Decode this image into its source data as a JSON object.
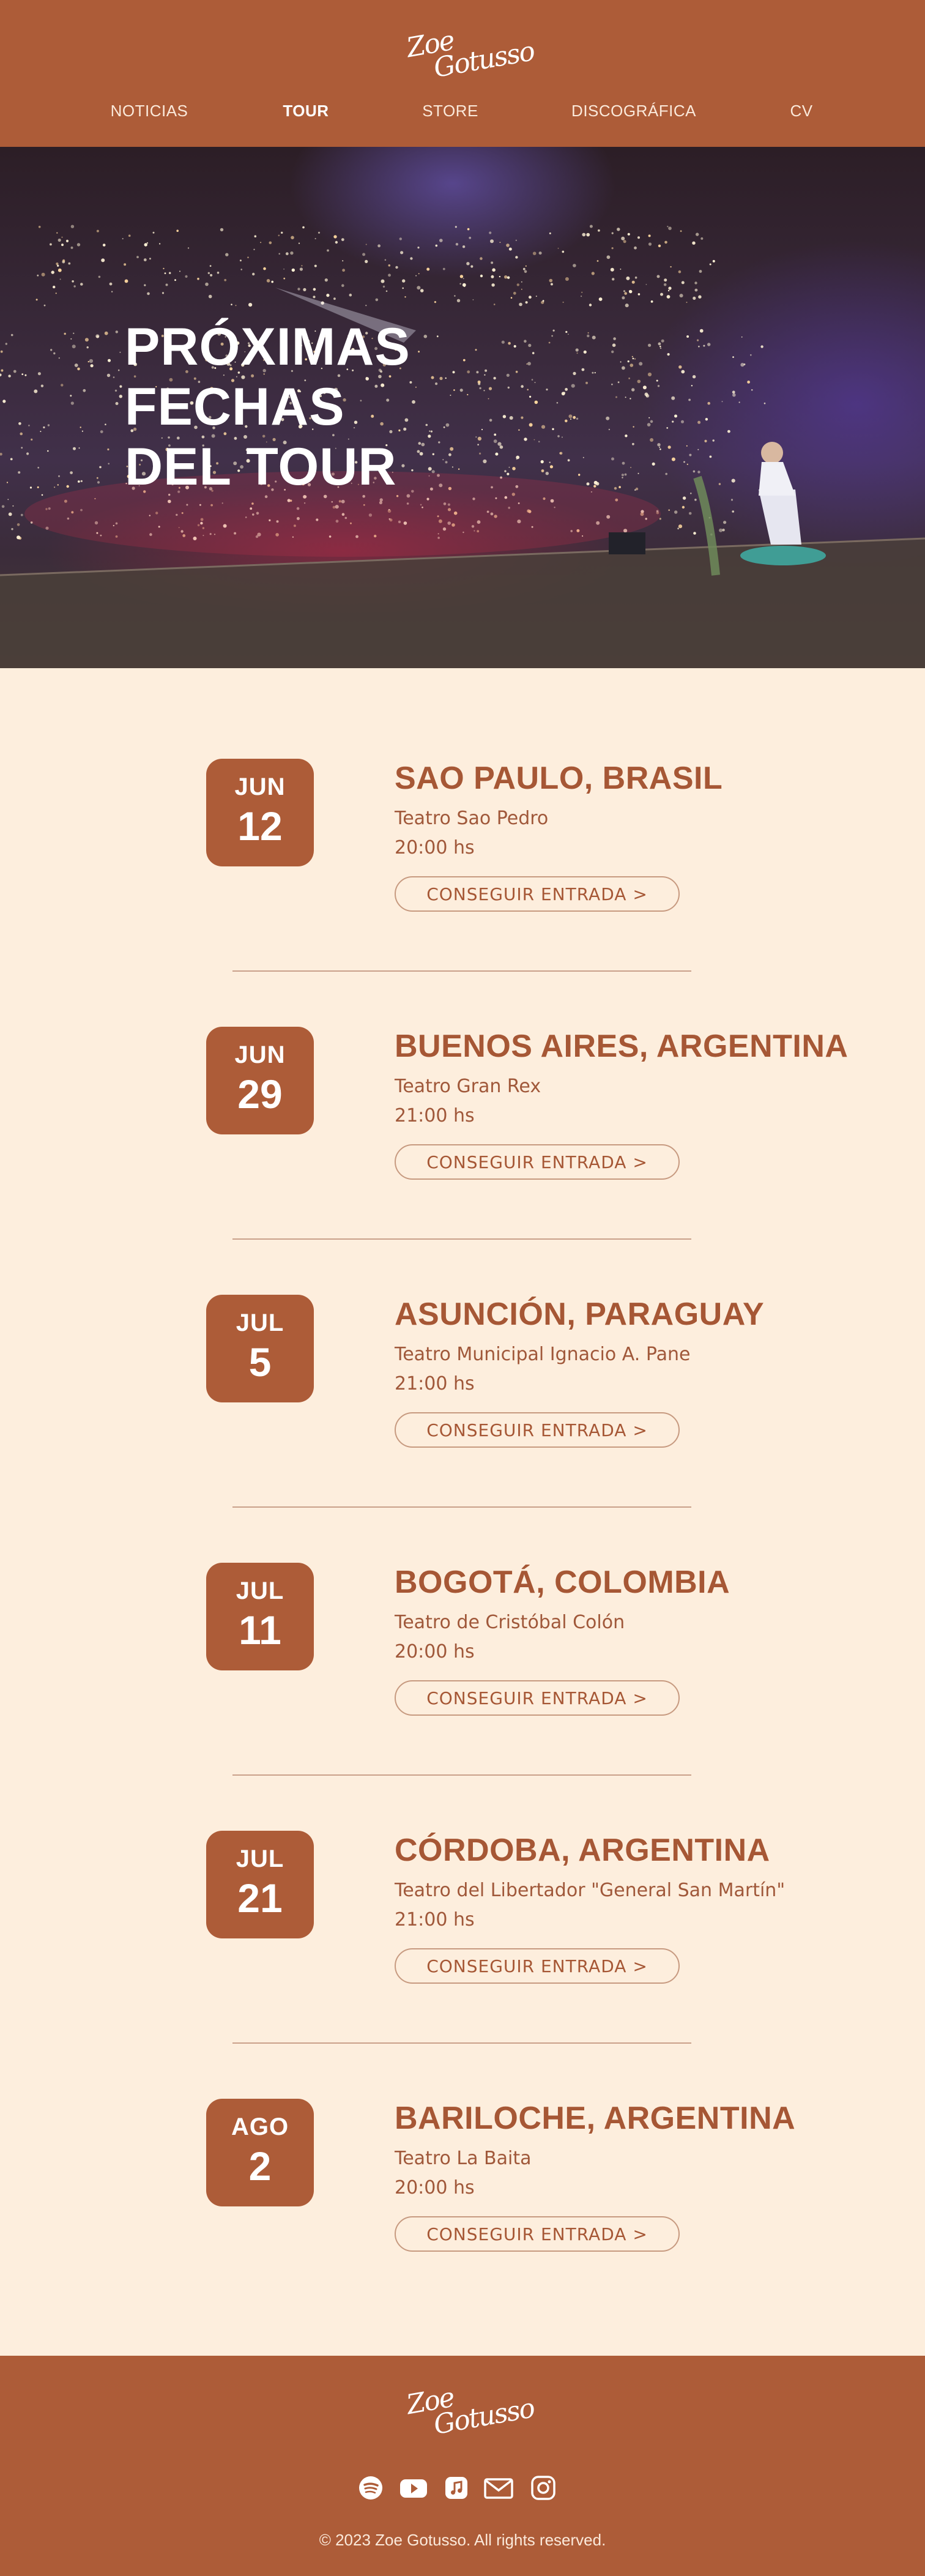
{
  "brand": {
    "logo_line1": "Zoe",
    "logo_line2": "Gotusso",
    "accent": "#ad5c38",
    "background": "#fdeedd"
  },
  "nav": {
    "items": [
      {
        "label": "NOTICIAS",
        "active": false
      },
      {
        "label": "TOUR",
        "active": true
      },
      {
        "label": "STORE",
        "active": false
      },
      {
        "label": "DISCOGRÁFICA",
        "active": false
      },
      {
        "label": "CV",
        "active": false
      }
    ]
  },
  "hero": {
    "title_lines": [
      "PRÓXIMAS",
      "FECHAS",
      "DEL TOUR"
    ]
  },
  "events": [
    {
      "month": "JUN",
      "day": "12",
      "city": "SAO PAULO, BRASIL",
      "venue": "Teatro Sao Pedro",
      "time": "20:00 hs",
      "button": "CONSEGUIR ENTRADA >"
    },
    {
      "month": "JUN",
      "day": "29",
      "city": "BUENOS AIRES, ARGENTINA",
      "venue": "Teatro Gran Rex",
      "time": "21:00 hs",
      "button": "CONSEGUIR ENTRADA >"
    },
    {
      "month": "JUL",
      "day": "5",
      "city": "ASUNCIÓN, PARAGUAY",
      "venue": "Teatro Municipal Ignacio A. Pane",
      "time": "21:00 hs",
      "button": "CONSEGUIR ENTRADA >"
    },
    {
      "month": "JUL",
      "day": "11",
      "city": "BOGOTÁ, COLOMBIA",
      "venue": "Teatro de Cristóbal Colón",
      "time": "20:00 hs",
      "button": "CONSEGUIR ENTRADA >"
    },
    {
      "month": "JUL",
      "day": "21",
      "city": "CÓRDOBA, ARGENTINA",
      "venue": "Teatro del Libertador \"General San Martín\"",
      "time": "21:00 hs",
      "button": "CONSEGUIR ENTRADA >"
    },
    {
      "month": "AGO",
      "day": "2",
      "city": "BARILOCHE, ARGENTINA",
      "venue": "Teatro La Baita",
      "time": "20:00 hs",
      "button": "CONSEGUIR ENTRADA >"
    }
  ],
  "footer": {
    "social_icons": [
      "spotify-icon",
      "youtube-icon",
      "apple-music-icon",
      "email-icon",
      "instagram-icon"
    ],
    "copyright": "© 2023 Zoe Gotusso. All rights reserved."
  }
}
